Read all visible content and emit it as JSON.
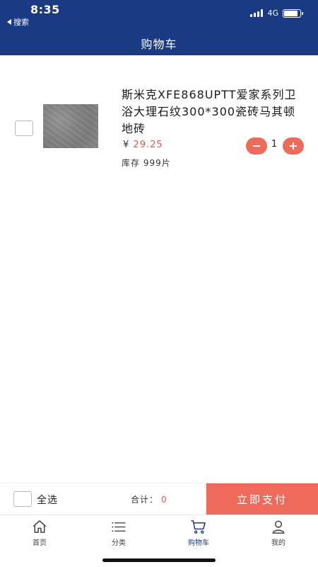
{
  "status_bar": {
    "time": "8:35",
    "back_app": "搜索",
    "network": "4G"
  },
  "header": {
    "title": "购物车"
  },
  "cart": {
    "items": [
      {
        "name": "斯米克XFE868UPTT爱家系列卫浴大理石纹300*300瓷砖马其顿地砖",
        "currency": "¥",
        "price": "29.25",
        "quantity": "1",
        "stock": "库存 999片",
        "checked": false,
        "image_icon": "tile-thumbnail"
      }
    ]
  },
  "checkout": {
    "select_all": "全选",
    "total_label": "合计：",
    "total_value": "0",
    "pay_button": "立即支付"
  },
  "tabbar": {
    "tabs": [
      {
        "label": "首页",
        "icon": "home-icon",
        "active": false
      },
      {
        "label": "分类",
        "icon": "list-icon",
        "active": false
      },
      {
        "label": "购物车",
        "icon": "cart-icon",
        "active": true
      },
      {
        "label": "我的",
        "icon": "user-icon",
        "active": false
      }
    ]
  },
  "colors": {
    "brand": "#1b3a84",
    "accent": "#ee6b5c",
    "price": "#e8584a"
  }
}
